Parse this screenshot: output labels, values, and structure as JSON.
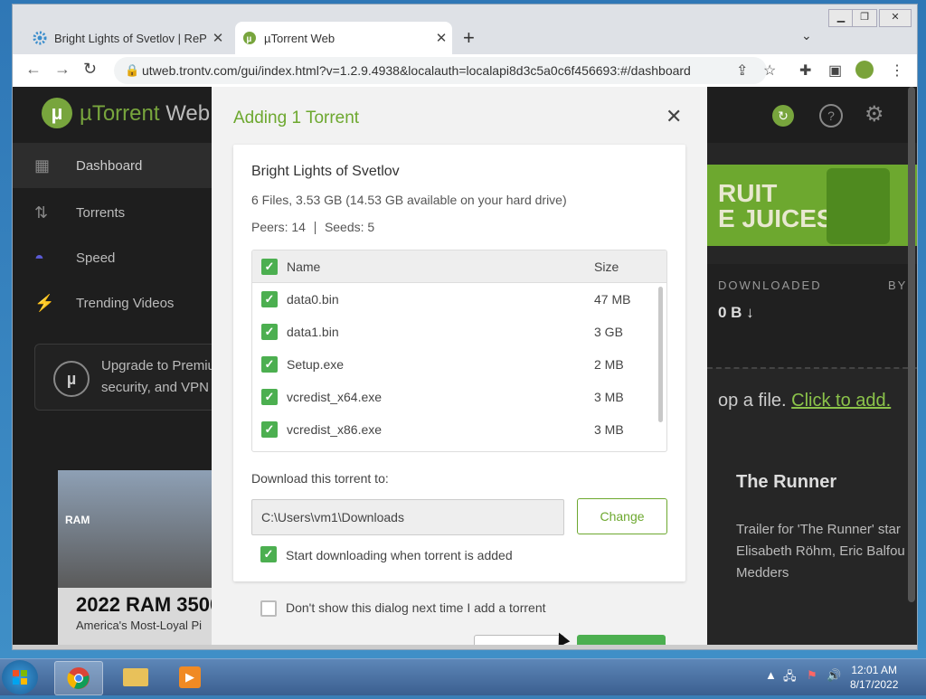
{
  "browser": {
    "tabs": [
      {
        "title": "Bright Lights of Svetlov | RePack"
      },
      {
        "title": "µTorrent Web"
      }
    ],
    "new_tab": "+",
    "url": "utweb.trontv.com/gui/index.html?v=1.2.9.4938&localauth=localapi8d3c5a0c6f456693:#/dashboard"
  },
  "app": {
    "brand_main": "µTorrent",
    "brand_sub": " Web",
    "sidebar": [
      {
        "label": "Dashboard",
        "icon": "grid-icon"
      },
      {
        "label": "Torrents",
        "icon": "up-down-arrows-icon"
      },
      {
        "label": "Speed",
        "icon": "speedometer-icon"
      },
      {
        "label": "Trending Videos",
        "icon": "video-lightning-icon"
      }
    ],
    "upgrade_text": "Upgrade to Premiu\nsecurity, and VPN",
    "ad_banner_text": "RUIT\nE JUICES",
    "stat_label": "DOWNLOADED",
    "stat_value": "0 B ↓",
    "stat_label2": "BY",
    "drop_text": "op a file.",
    "drop_link": "Click to add.",
    "ad_ram_title": "2022 RAM 3500",
    "ad_ram_sub": "America's Most-Loyal Pi",
    "ad_ram_brand": "RAM",
    "video_title": "The Runner",
    "video_desc": "Trailer for 'The Runner' star\nElisabeth Röhm, Eric Balfou\nMedders"
  },
  "dialog": {
    "title": "Adding 1 Torrent",
    "torrent_name": "Bright Lights of Svetlov",
    "files_info": "6 Files,  3.53 GB  (14.53 GB available on your hard drive)",
    "peers": "Peers: 14",
    "seeds": "Seeds: 5",
    "col_name": "Name",
    "col_size": "Size",
    "files": [
      {
        "name": "data0.bin",
        "size": "47 MB"
      },
      {
        "name": "data1.bin",
        "size": "3 GB"
      },
      {
        "name": "Setup.exe",
        "size": "2 MB"
      },
      {
        "name": "vcredist_x64.exe",
        "size": "3 MB"
      },
      {
        "name": "vcredist_x86.exe",
        "size": "3 MB"
      }
    ],
    "download_label": "Download this torrent to:",
    "download_path": "C:\\Users\\vm1\\Downloads",
    "change_button": "Change",
    "start_label": "Start downloading when torrent is added",
    "dont_show_label": "Don't show this dialog next time I add a torrent"
  },
  "taskbar": {
    "time": "12:01 AM",
    "date": "8/17/2022"
  },
  "colors": {
    "accent": "#6da82f",
    "checkbox": "#4caf50",
    "app_bg": "#262626"
  }
}
